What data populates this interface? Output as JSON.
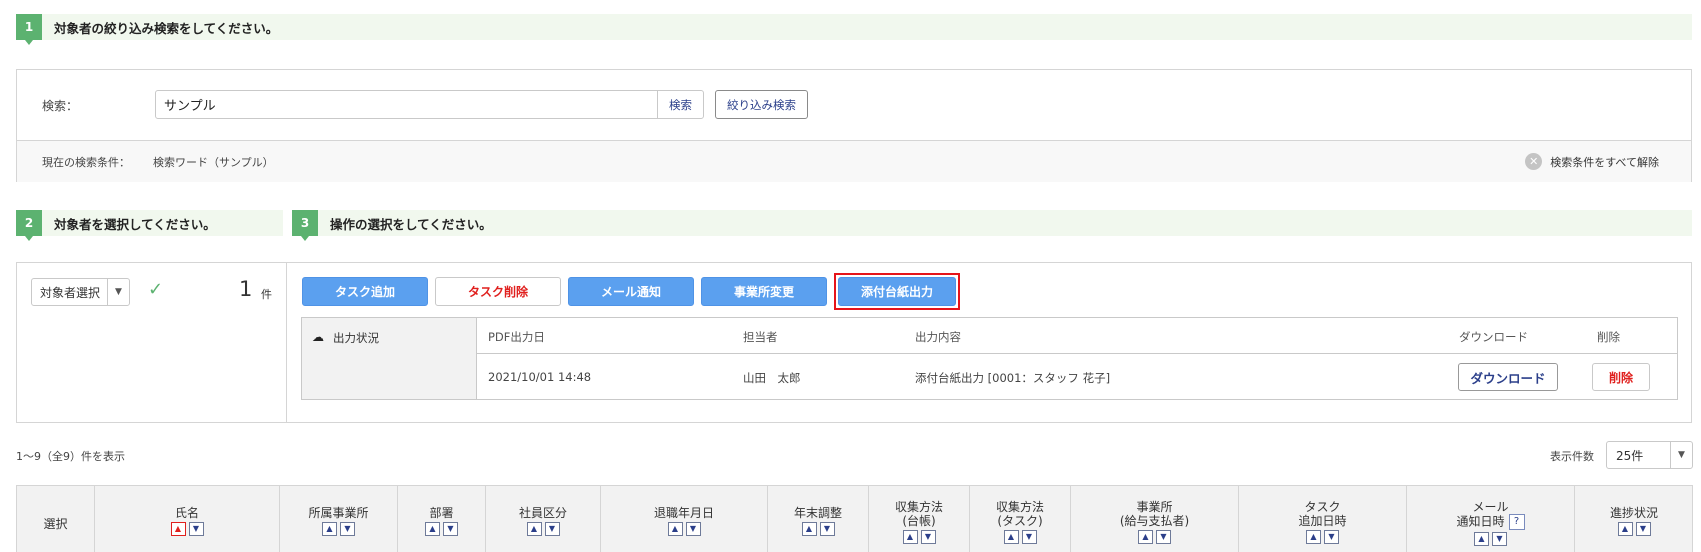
{
  "step1": {
    "num": "1",
    "title": "対象者の絞り込み検索をしてください。"
  },
  "step2": {
    "num": "2",
    "title": "対象者を選択してください。"
  },
  "step3": {
    "num": "3",
    "title": "操作の選択をしてください。"
  },
  "search": {
    "label": "検索：",
    "value": "サンプル",
    "search_button": "検索",
    "filter_button": "絞り込み検索",
    "condition_label": "現在の検索条件：",
    "condition_value": "検索ワード（サンプル）",
    "clear_all": "検索条件をすべて解除"
  },
  "selection": {
    "target_select": "対象者選択",
    "count": "1",
    "count_unit": "件"
  },
  "operations": {
    "add_task": "タスク追加",
    "delete_task": "タスク削除",
    "mail_notify": "メール通知",
    "office_change": "事業所変更",
    "ledger_output": "添付台紙出力"
  },
  "output_status": {
    "label": "出力状況",
    "headers": {
      "pdf_date": "PDF出力日",
      "person": "担当者",
      "content": "出力内容",
      "download": "ダウンロード",
      "delete": "削除"
    },
    "row": {
      "pdf_date": "2021/10/01 14:48",
      "person": "山田　太郎",
      "content": "添付台紙出力 [0001：スタッフ 花子]",
      "download_button": "ダウンロード",
      "delete_button": "削除"
    }
  },
  "list": {
    "result_text": "1～9（全9）件を表示",
    "per_page_label": "表示件数",
    "per_page_value": "25件"
  },
  "grid_columns": [
    {
      "line1": "選択",
      "line2": ""
    },
    {
      "line1": "氏名",
      "line2": ""
    },
    {
      "line1": "所属事業所",
      "line2": ""
    },
    {
      "line1": "部署",
      "line2": ""
    },
    {
      "line1": "社員区分",
      "line2": ""
    },
    {
      "line1": "退職年月日",
      "line2": ""
    },
    {
      "line1": "年末調整",
      "line2": ""
    },
    {
      "line1": "収集方法",
      "line2": "(台帳)"
    },
    {
      "line1": "収集方法",
      "line2": "(タスク)"
    },
    {
      "line1": "事業所",
      "line2": "(給与支払者)"
    },
    {
      "line1": "タスク",
      "line2": "追加日時"
    },
    {
      "line1": "メール",
      "line2": "通知日時"
    },
    {
      "line1": "進捗状況",
      "line2": ""
    }
  ],
  "icons": {
    "check": "check-icon",
    "clear": "close-circle-icon",
    "cloud": "cloud-download-icon",
    "help": "help-icon"
  },
  "colors": {
    "accent_green": "#5cb270",
    "primary_blue": "#5ba0ef",
    "danger_red": "#e0201e",
    "highlight": "#e6141a"
  }
}
